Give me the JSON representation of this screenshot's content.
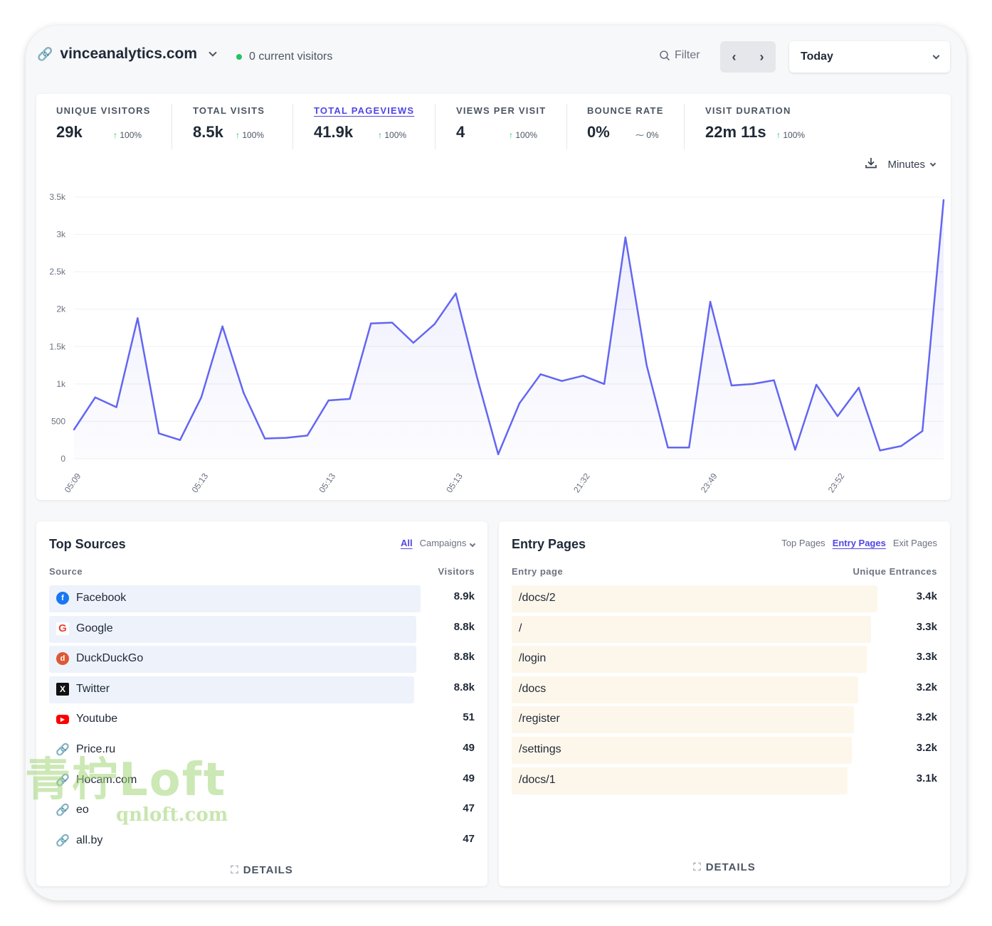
{
  "header": {
    "site": "vinceanalytics.com",
    "current_visitors": "0 current visitors",
    "filter_label": "Filter",
    "period": "Today"
  },
  "metrics": [
    {
      "label": "UNIQUE VISITORS",
      "value": "29k",
      "change": "100%"
    },
    {
      "label": "TOTAL VISITS",
      "value": "8.5k",
      "change": "100%"
    },
    {
      "label": "TOTAL PAGEVIEWS",
      "value": "41.9k",
      "change": "100%"
    },
    {
      "label": "VIEWS PER VISIT",
      "value": "4",
      "change": "100%"
    },
    {
      "label": "BOUNCE RATE",
      "value": "0%",
      "change": "0%"
    },
    {
      "label": "VISIT DURATION",
      "value": "22m 11s",
      "change": "100%"
    }
  ],
  "chart_controls": {
    "interval": "Minutes"
  },
  "chart_data": {
    "type": "area",
    "ylim": [
      0,
      3500
    ],
    "y_ticks": [
      "0",
      "500",
      "1k",
      "1.5k",
      "2k",
      "2.5k",
      "3k",
      "3.5k"
    ],
    "y_tick_values": [
      0,
      500,
      1000,
      1500,
      2000,
      2500,
      3000,
      3500
    ],
    "x_tick_labels": [
      "05:09",
      "05:13",
      "05:13",
      "05:13",
      "21:32",
      "23:49",
      "23:52"
    ],
    "x_tick_index": [
      0,
      6,
      12,
      18,
      24,
      30,
      36
    ],
    "values": [
      390,
      820,
      690,
      1880,
      340,
      250,
      820,
      1770,
      880,
      270,
      280,
      310,
      780,
      800,
      1810,
      1820,
      1550,
      1800,
      2210,
      1090,
      60,
      740,
      1130,
      1040,
      1110,
      1000,
      2960,
      1250,
      150,
      150,
      2100,
      980,
      1000,
      1050,
      120,
      990,
      570,
      950,
      110,
      170,
      370,
      3460
    ],
    "color": "#6366f1"
  },
  "top_sources": {
    "title": "Top Sources",
    "tabs": [
      "All",
      "Campaigns"
    ],
    "col_source": "Source",
    "col_visitors": "Visitors",
    "rows": [
      {
        "name": "Facebook",
        "value": "8.9k",
        "icon": "facebook-icon",
        "glyph": "f",
        "pct": 0.9
      },
      {
        "name": "Google",
        "value": "8.8k",
        "icon": "google-icon",
        "glyph": "G",
        "pct": 0.89
      },
      {
        "name": "DuckDuckGo",
        "value": "8.8k",
        "icon": "duckduckgo-icon",
        "glyph": "d",
        "pct": 0.89
      },
      {
        "name": "Twitter",
        "value": "8.8k",
        "icon": "x-twitter-icon",
        "glyph": "X",
        "pct": 0.885
      },
      {
        "name": "Youtube",
        "value": "51",
        "icon": "youtube-icon",
        "glyph": "▶",
        "pct": 0
      },
      {
        "name": "Price.ru",
        "value": "49",
        "icon": "link-icon",
        "glyph": "🔗",
        "pct": 0
      },
      {
        "name": "Hocam.com",
        "value": "49",
        "icon": "link-icon",
        "glyph": "🔗",
        "pct": 0
      },
      {
        "name": "eo",
        "value": "47",
        "icon": "link-icon",
        "glyph": "🔗",
        "pct": 0
      },
      {
        "name": "all.by",
        "value": "47",
        "icon": "link-icon",
        "glyph": "🔗",
        "pct": 0
      }
    ],
    "details": "DETAILS"
  },
  "entry_pages": {
    "title": "Entry Pages",
    "tabs": [
      "Top Pages",
      "Entry Pages",
      "Exit Pages"
    ],
    "col_page": "Entry page",
    "col_value": "Unique Entrances",
    "rows": [
      {
        "name": "/docs/2",
        "value": "3.4k",
        "pct": 0.86
      },
      {
        "name": "/",
        "value": "3.3k",
        "pct": 0.845
      },
      {
        "name": "/login",
        "value": "3.3k",
        "pct": 0.835
      },
      {
        "name": "/docs",
        "value": "3.2k",
        "pct": 0.815
      },
      {
        "name": "/register",
        "value": "3.2k",
        "pct": 0.805
      },
      {
        "name": "/settings",
        "value": "3.2k",
        "pct": 0.8
      },
      {
        "name": "/docs/1",
        "value": "3.1k",
        "pct": 0.79
      }
    ],
    "details": "DETAILS"
  },
  "watermark": {
    "brand": "青柠Loft",
    "url": "qnloft.com"
  }
}
